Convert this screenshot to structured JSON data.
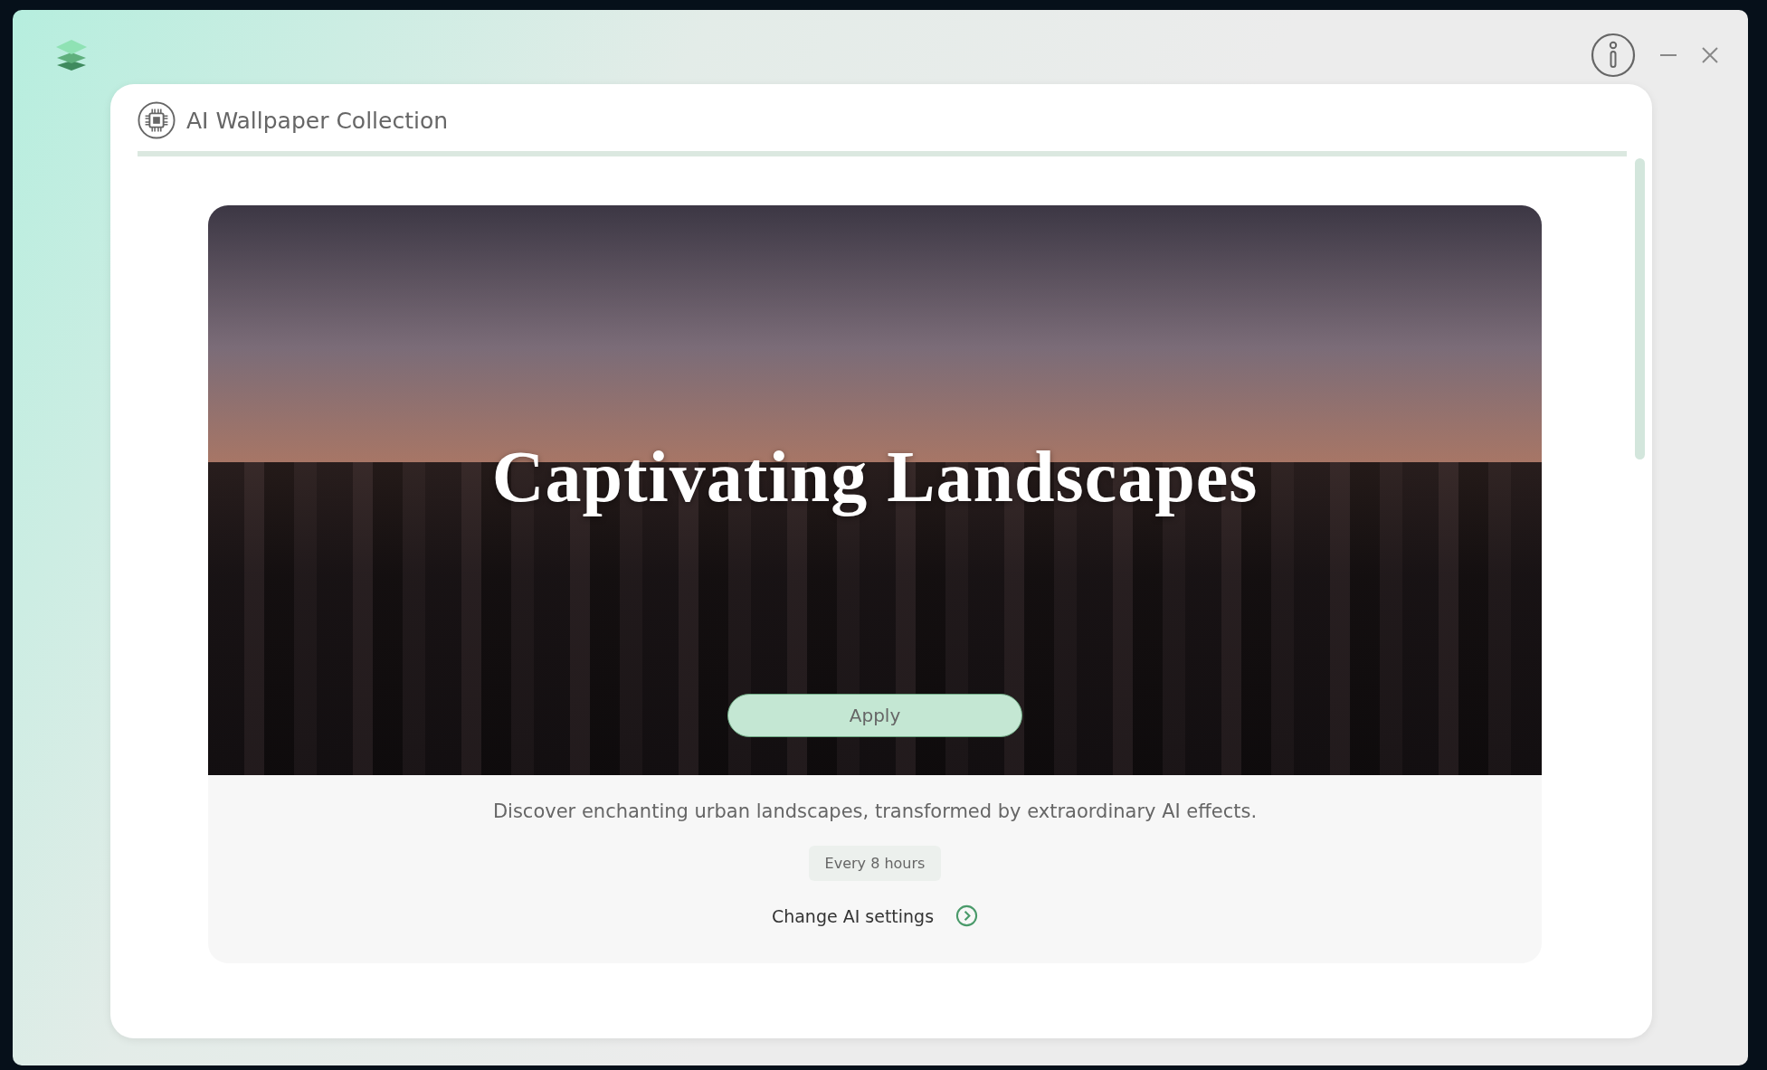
{
  "card": {
    "title": "AI Wallpaper Collection"
  },
  "wallpaper": {
    "title": "Captivating Landscapes",
    "apply_button": "Apply",
    "description": "Discover enchanting urban landscapes, transformed by extraordinary AI effects.",
    "interval": "Every 8 hours",
    "settings_link": "Change AI settings"
  }
}
